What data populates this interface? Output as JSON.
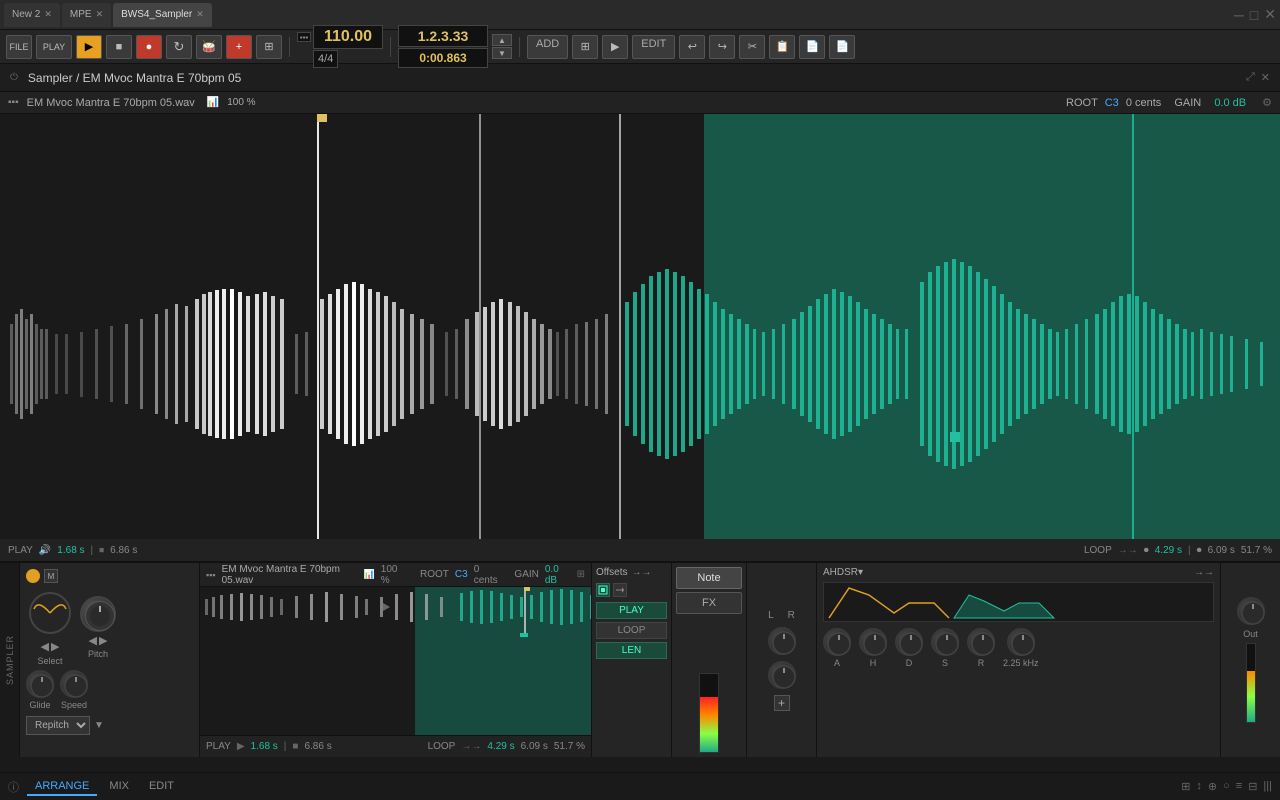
{
  "tabs": [
    {
      "label": "New 2",
      "active": false,
      "closable": true
    },
    {
      "label": "MPE",
      "active": false,
      "closable": true
    },
    {
      "label": "BWS4_Sampler",
      "active": true,
      "closable": true
    }
  ],
  "transport": {
    "file_label": "FILE",
    "play_label": "PLAY",
    "bpm": "110.00",
    "time_sig": "4/4",
    "position_bars": "1.2.3.33",
    "position_time": "0:00.863",
    "add_label": "ADD",
    "mix_label": "",
    "play2_label": "",
    "edit_label": "EDIT"
  },
  "sampler": {
    "title": "Sampler / EM Mvoc Mantra E 70bpm 05",
    "file_name": "EM Mvoc Mantra E 70bpm 05.wav",
    "zoom_percent": "100 %",
    "root_label": "ROOT",
    "root_note": "C3",
    "cents": "0 cents",
    "gain_label": "GAIN",
    "gain_value": "0.0 dB",
    "play_pos": "1.68 s",
    "total_len": "6.86 s",
    "loop_label": "LOOP",
    "loop_start": "4.29 s",
    "loop_end": "6.09 s",
    "loop_percent": "51.7 %"
  },
  "lower": {
    "file_name2": "EM Mvoc Mantra E 70bpm 05.wav",
    "zoom2": "100 %",
    "root2": "ROOT",
    "note2": "C3",
    "cents2": "0 cents",
    "gain2": "GAIN",
    "gain_val2": "0.0 dB",
    "play_pos2": "1.68 s",
    "len2": "6.86 s",
    "loop2": "LOOP",
    "loop_start2": "4.29 s",
    "loop_end2": "6.09 s",
    "loop_pct2": "51.7 %",
    "note_btn": "Note",
    "fx_btn": "FX",
    "lr_l": "L",
    "lr_r": "R",
    "ahdsr_label": "AHDSR▾",
    "ahdsr_a": "A",
    "ahdsr_h": "H",
    "ahdsr_d": "D",
    "ahdsr_s": "S",
    "ahdsr_r": "R",
    "out_label": "Out",
    "select_label": "Select",
    "pitch_label": "Pitch",
    "glide_label": "Glide",
    "speed_label": "Speed",
    "repitch_label": "Repitch",
    "offsets_label": "Offsets",
    "play_offset": "PLAY",
    "loop_offset": "LOOP",
    "len_offset": "LEN",
    "freq_value": "2.25 kHz"
  },
  "status_bar": {
    "arrange_label": "ARRANGE",
    "mix_label": "MIX",
    "edit_label": "EDIT"
  }
}
